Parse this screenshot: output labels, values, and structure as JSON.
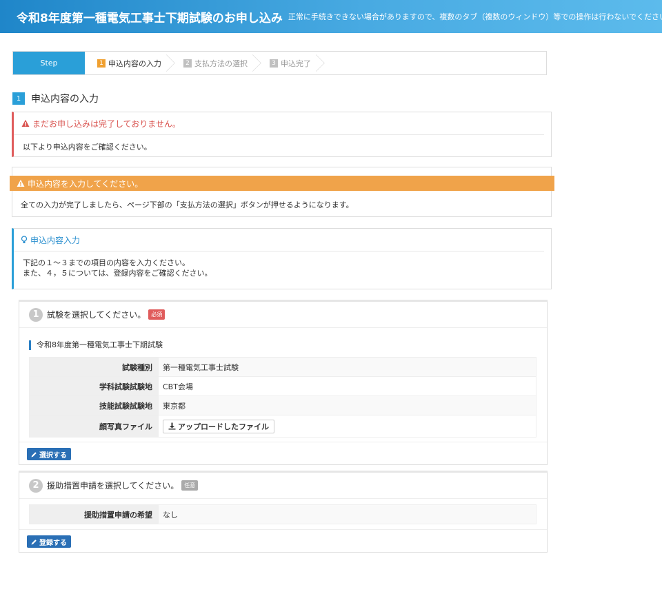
{
  "header": {
    "title": "令和8年度第一種電気工事士下期試験のお申し込み",
    "notice": "正常に手続きできない場合がありますので、複数のタブ（複数のウィンドウ）等での操作は行わないでください。"
  },
  "steps": {
    "label": "Step",
    "items": [
      {
        "num": "1",
        "label": "申込内容の入力"
      },
      {
        "num": "2",
        "label": "支払方法の選択"
      },
      {
        "num": "3",
        "label": "申込完了"
      }
    ]
  },
  "section": {
    "num": "1",
    "title": "申込内容の入力"
  },
  "alert_red": {
    "title": "まだお申し込みは完了しておりません。",
    "body": "以下より申込内容をご確認ください。"
  },
  "alert_orange": {
    "title": "申込内容を入力してください。",
    "body": "全ての入力が完了しましたら、ページ下部の「支払方法の選択」ボタンが押せるようになります。"
  },
  "alert_blue": {
    "title": "申込内容入力",
    "line1": "下記の１～３までの項目の内容を入力ください。",
    "line2": "また、４，５については、登録内容をご確認ください。"
  },
  "panel1": {
    "num": "1",
    "title": "試験を選択してください。",
    "tag": "必須",
    "sub_title": "令和8年度第一種電気工事士下期試験",
    "rows": [
      {
        "label": "試験種別",
        "value": "第一種電気工事士試験"
      },
      {
        "label": "学科試験試験地",
        "value": "CBT会場"
      },
      {
        "label": "技能試験試験地",
        "value": "東京都"
      },
      {
        "label": "顔写真ファイル",
        "value": "アップロードしたファイル"
      }
    ],
    "button": "選択する"
  },
  "panel2": {
    "num": "2",
    "title": "援助措置申請を選択してください。",
    "tag": "任意",
    "rows": [
      {
        "label": "援助措置申請の希望",
        "value": "なし"
      }
    ],
    "button": "登録する"
  },
  "colors": {
    "header": "#2a9fd8",
    "step_active": "#2a9fd8",
    "alert_red": "#e05c5c",
    "alert_orange": "#f0a34a",
    "alert_blue": "#2a9fd8",
    "action_button": "#2a6fb5"
  }
}
